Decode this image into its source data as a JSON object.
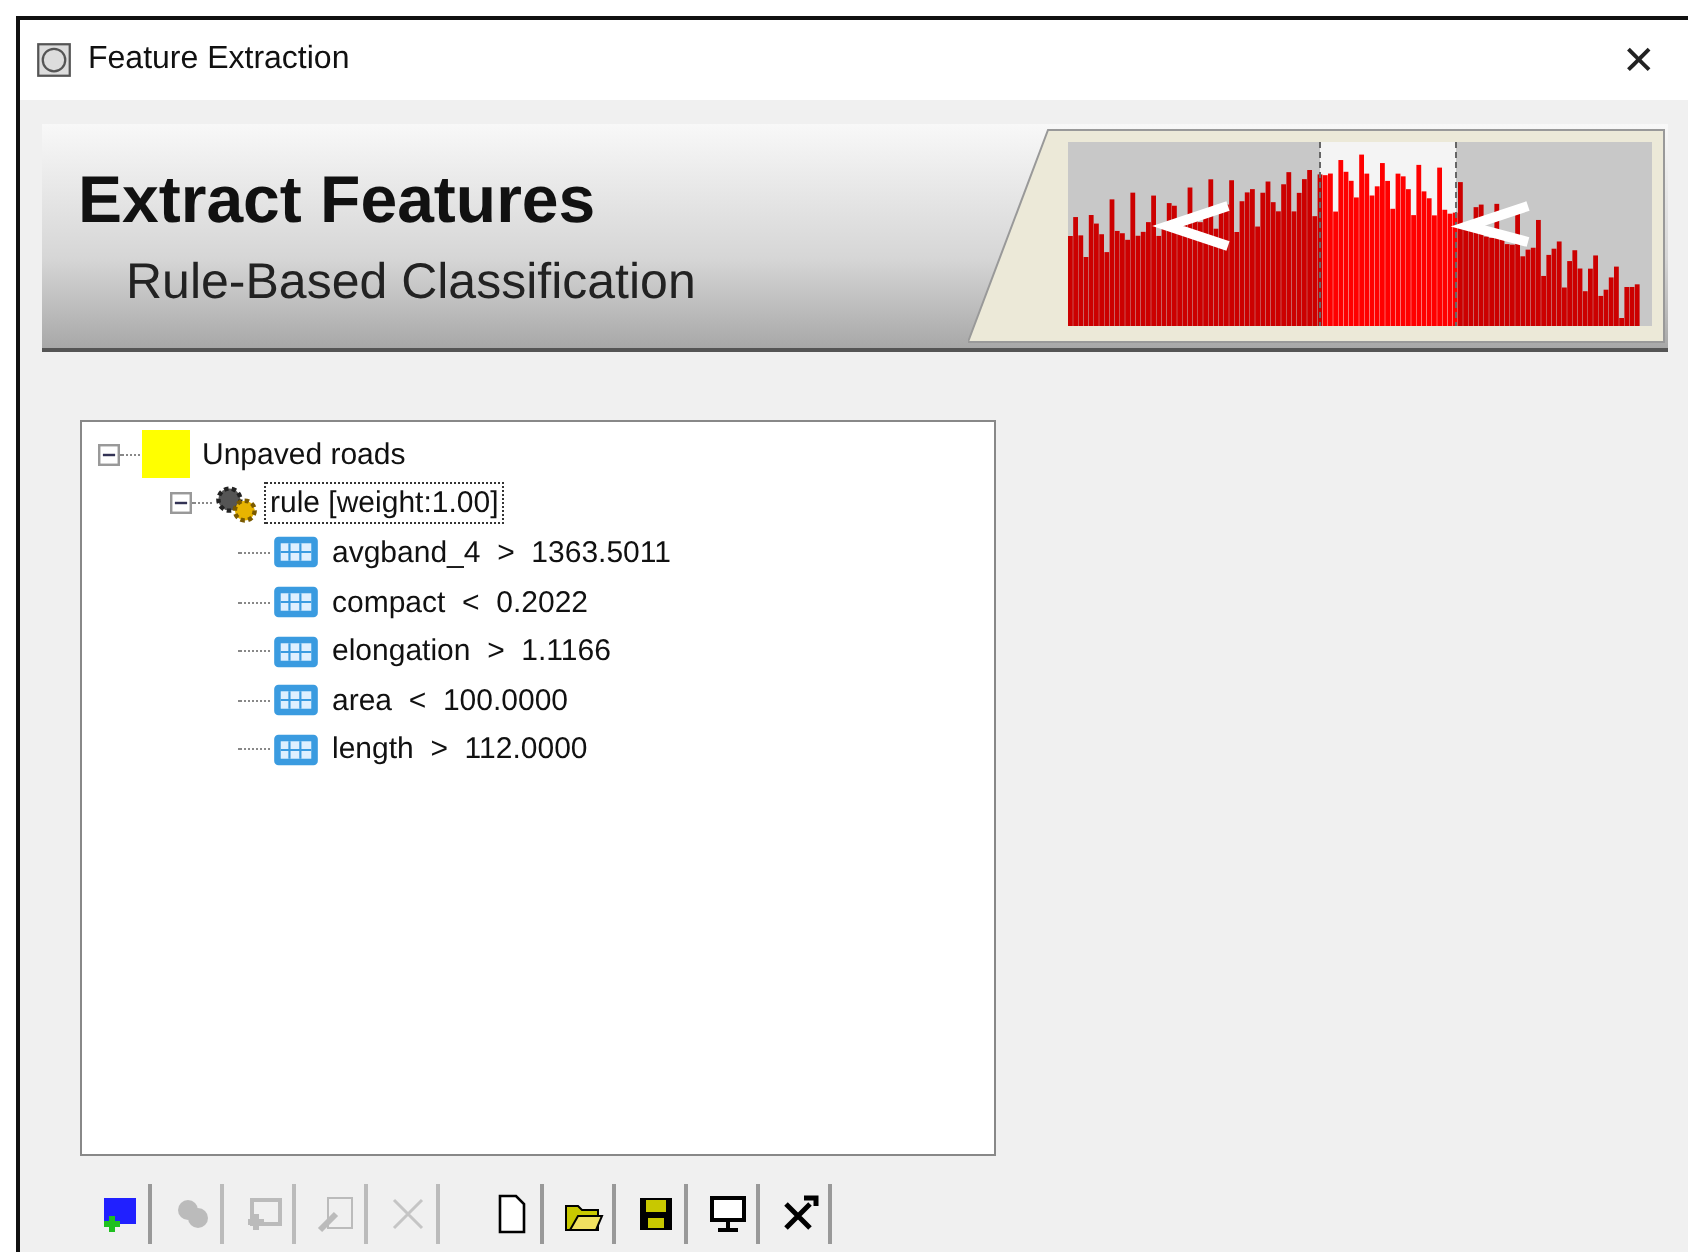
{
  "window": {
    "title": "Feature Extraction",
    "close": "✕"
  },
  "banner": {
    "title": "Extract Features",
    "subtitle": "Rule-Based Classification"
  },
  "tree": [
    {
      "kind": "class",
      "label": "Unpaved roads",
      "color": "#ffff00",
      "expanded": true,
      "selected": false,
      "children": [
        {
          "kind": "rule",
          "label": "rule [weight:1.00]",
          "expanded": true,
          "selected": true,
          "children": [
            {
              "kind": "attribute",
              "label": "avgband_4  >  1363.5011",
              "selected": false
            },
            {
              "kind": "attribute",
              "label": "compact  <  0.2022",
              "selected": false
            },
            {
              "kind": "attribute",
              "label": "elongation  >  1.1166",
              "selected": false
            },
            {
              "kind": "attribute",
              "label": "area  <  100.0000",
              "selected": false
            },
            {
              "kind": "attribute",
              "label": "length  >  112.0000",
              "selected": false
            }
          ]
        }
      ]
    }
  ],
  "toolbar_groups": [
    [
      {
        "kind": "add-class",
        "disabled": false
      },
      {
        "kind": "add-rule",
        "disabled": true
      },
      {
        "kind": "add-attribute",
        "disabled": true
      },
      {
        "kind": "edit",
        "disabled": true
      },
      {
        "kind": "delete",
        "disabled": true
      }
    ],
    [
      {
        "kind": "new",
        "disabled": false
      },
      {
        "kind": "open",
        "disabled": false
      },
      {
        "kind": "save",
        "disabled": false
      },
      {
        "kind": "display",
        "disabled": false
      },
      {
        "kind": "tools",
        "disabled": false
      }
    ]
  ]
}
